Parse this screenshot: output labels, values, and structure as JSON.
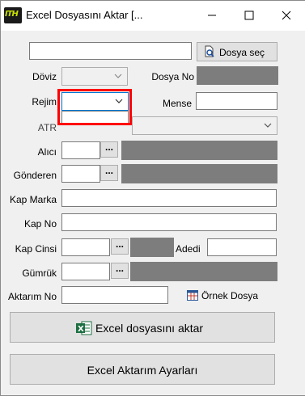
{
  "window": {
    "title": "Excel Dosyasını Aktar  [...",
    "app_icon_text": "ITH"
  },
  "top": {
    "file_path_value": "",
    "select_file_label": "Dosya seç"
  },
  "fields": {
    "doviz_label": "Döviz",
    "dosya_no_label": "Dosya No",
    "rejim_label": "Rejim",
    "mense_label": "Mense",
    "atr_label": "ATR",
    "alici_label": "Alıcı",
    "gonderen_label": "Gönderen",
    "kap_marka_label": "Kap Marka",
    "kap_no_label": "Kap No",
    "kap_cinsi_label": "Kap Cinsi",
    "adedi_label": "Adedi",
    "gumruk_label": "Gümrük",
    "aktarim_no_label": "Aktarım No",
    "ornek_dosya_label": "Örnek Dosya",
    "dots": "..."
  },
  "buttons": {
    "import_label": "Excel dosyasını aktar",
    "settings_label": "Excel Aktarım Ayarları"
  },
  "colors": {
    "highlight": "#ff0000",
    "readonly_fill": "#7d7d7d",
    "focus_border": "#0078d7"
  }
}
